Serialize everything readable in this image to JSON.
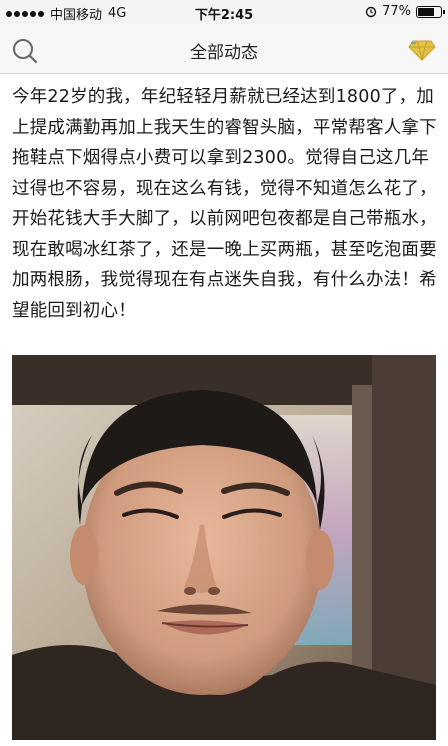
{
  "status_bar": {
    "carrier": "中国移动",
    "network": "4G",
    "time": "下午2:45",
    "battery_percent": "77%",
    "battery_level": 0.77
  },
  "nav": {
    "title": "全部动态",
    "left_icon": "search-icon",
    "right_icon": "diamond-icon"
  },
  "post": {
    "text": "今年22岁的我，年纪轻轻月薪就已经达到1800了，加上提成满勤再加上我天生的睿智头脑，平常帮客人拿下拖鞋点下烟得点小费可以拿到2300。觉得自己这几年过得也不容易，现在这么有钱，觉得不知道怎么花了，开始花钱大手大脚了，以前网吧包夜都是自己带瓶水，现在敢喝冰红茶了，还是一晚上买两瓶，甚至吃泡面要加两根肠，我觉得现在有点迷失自我，有什么办法！希望能回到初心！"
  },
  "colors": {
    "nav_bg": "#f7f7f7",
    "accent_gem": "#c9a227",
    "text": "#1a1a1a"
  }
}
